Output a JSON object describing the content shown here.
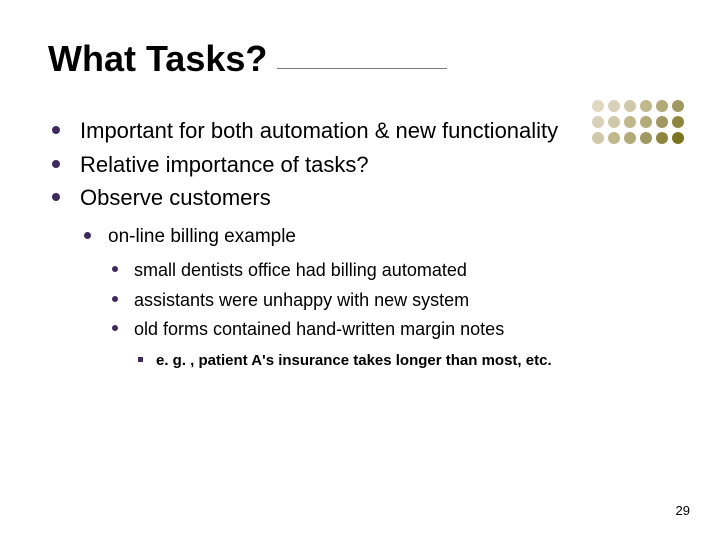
{
  "title": "What Tasks?",
  "bullets_lvl1": [
    "Important for both automation & new functionality",
    "Relative importance of tasks?",
    "Observe customers"
  ],
  "lvl2": {
    "item0": "on-line billing example"
  },
  "lvl3": {
    "item0": "small dentists office had billing automated",
    "item1": "assistants were unhappy with new system",
    "item2": "old forms contained hand-written margin notes"
  },
  "lvl4": {
    "item0": "e. g. , patient A's insurance takes longer than most, etc."
  },
  "page_number": "29",
  "deco_colors": [
    "#e0d8c0",
    "#d8d0b8",
    "#cfc8a8",
    "#c0b88c",
    "#b2aa78",
    "#a09860",
    "#d8d0b8",
    "#cfc8a8",
    "#c0b88c",
    "#b2aa78",
    "#a09860",
    "#8e863f",
    "#cfc8a8",
    "#c0b88c",
    "#b2aa78",
    "#a09860",
    "#8e863f",
    "#7a7420"
  ]
}
